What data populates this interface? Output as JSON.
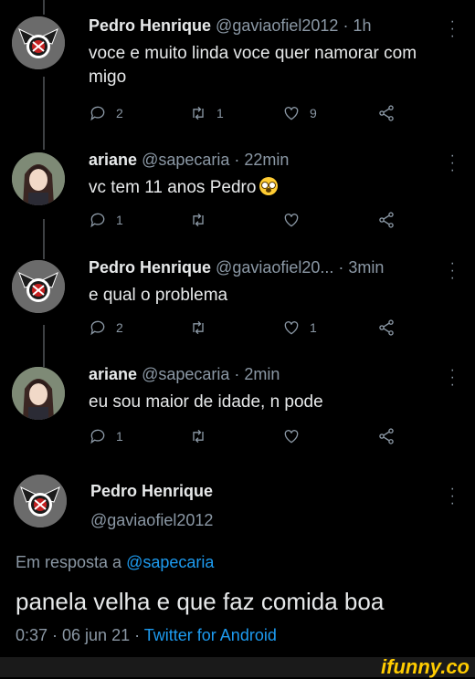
{
  "tweets": [
    {
      "name": "Pedro Henrique",
      "handle": "@gaviaofiel2012",
      "time": "· 1h",
      "text_line1": "voce e muito linda voce quer namorar com",
      "text_line2": "migo",
      "replies": "2",
      "retweets": "1",
      "likes": "9"
    },
    {
      "name": "ariane",
      "handle": "@sapecaria",
      "time": "· 22min",
      "text": "vc tem 11 anos Pedro",
      "replies": "1",
      "retweets": "",
      "likes": ""
    },
    {
      "name": "Pedro Henrique",
      "handle": "@gaviaofiel20...",
      "time": "· 3min",
      "text": "e qual o problema",
      "replies": "2",
      "retweets": "",
      "likes": "1"
    },
    {
      "name": "ariane",
      "handle": "@sapecaria",
      "time": "· 2min",
      "text": "eu sou maior de idade, n pode",
      "replies": "1",
      "retweets": "",
      "likes": ""
    }
  ],
  "main": {
    "name": "Pedro Henrique",
    "handle": "@gaviaofiel2012",
    "reply_prefix": "Em resposta a",
    "reply_handle": "@sapecaria",
    "text": "panela velha e que faz comida boa",
    "timestamp": "0:37 · 06 jun 21 ·",
    "source": "Twitter for Android"
  },
  "watermark": "ifunny.co",
  "colors": {
    "background": "#000000",
    "link": "#1d9bf0",
    "muted": "#8b98a5",
    "watermark": "#ffcc00"
  }
}
